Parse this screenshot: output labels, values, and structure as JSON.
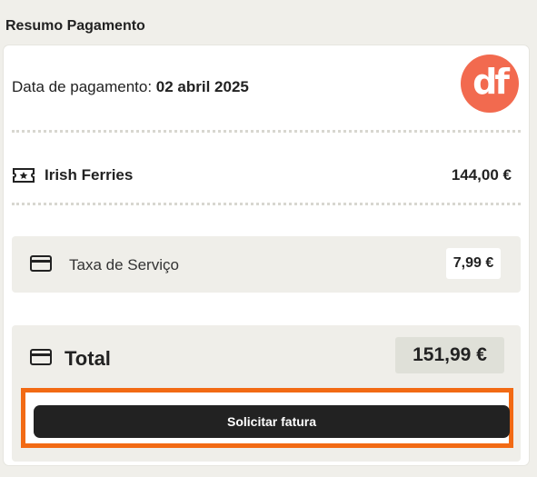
{
  "section_title": "Resumo Pagamento",
  "payment": {
    "date_label": "Data de pagamento:",
    "date_value": "02 abril 2025",
    "logo_text": "df",
    "brand_color": "#f26a4f"
  },
  "items": [
    {
      "icon": "ticket-icon",
      "name": "Irish Ferries",
      "amount": "144,00 €"
    }
  ],
  "service_fee": {
    "icon": "credit-card-icon",
    "label": "Taxa de Serviço",
    "amount": "7,99 €"
  },
  "total": {
    "icon": "credit-card-icon",
    "label": "Total",
    "amount": "151,99 €"
  },
  "actions": {
    "invoice_label": "Solicitar fatura",
    "highlight_color": "#f26a14"
  }
}
